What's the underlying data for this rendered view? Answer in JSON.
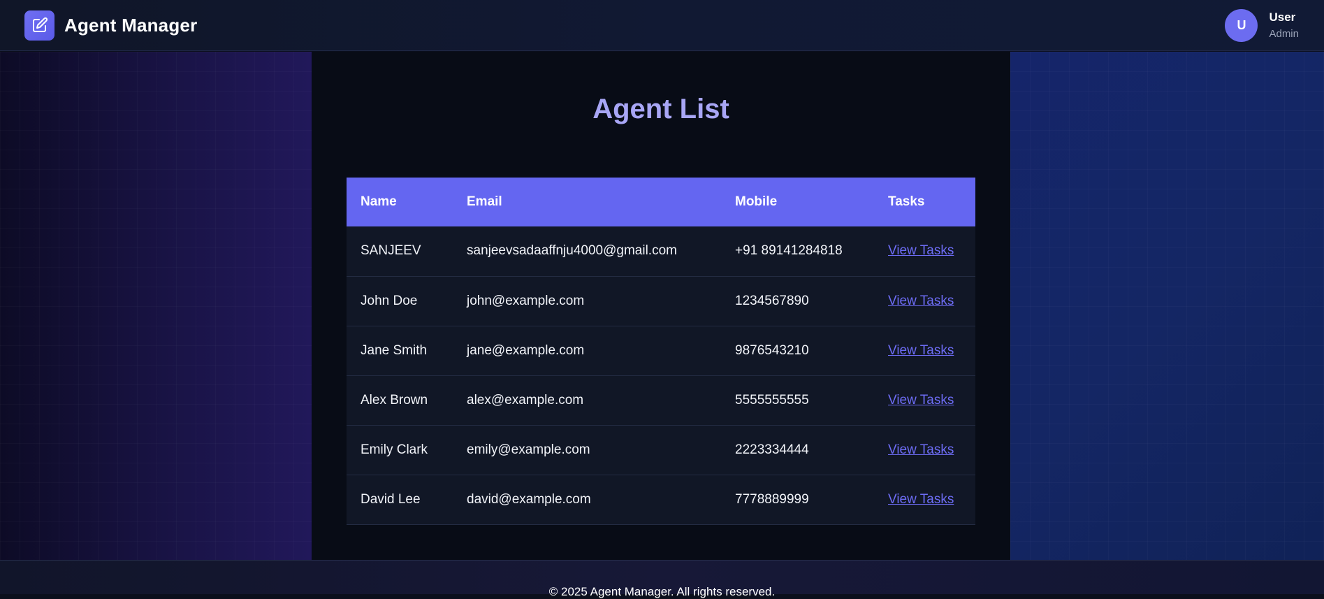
{
  "header": {
    "brand_icon": "edit-icon",
    "brand_title": "Agent Manager",
    "user": {
      "avatar_initial": "U",
      "name": "User",
      "role": "Admin"
    }
  },
  "main": {
    "title": "Agent List",
    "table": {
      "columns": [
        "Name",
        "Email",
        "Mobile",
        "Tasks"
      ],
      "rows": [
        {
          "name": "SANJEEV",
          "email": "sanjeevsadaaffnju4000@gmail.com",
          "mobile": "+91 89141284818",
          "tasks": "View Tasks"
        },
        {
          "name": "John Doe",
          "email": "john@example.com",
          "mobile": "1234567890",
          "tasks": "View Tasks"
        },
        {
          "name": "Jane Smith",
          "email": "jane@example.com",
          "mobile": "9876543210",
          "tasks": "View Tasks"
        },
        {
          "name": "Alex Brown",
          "email": "alex@example.com",
          "mobile": "5555555555",
          "tasks": "View Tasks"
        },
        {
          "name": "Emily Clark",
          "email": "emily@example.com",
          "mobile": "2223334444",
          "tasks": "View Tasks"
        },
        {
          "name": "David Lee",
          "email": "david@example.com",
          "mobile": "7778889999",
          "tasks": "View Tasks"
        }
      ]
    }
  },
  "footer": {
    "text": "© 2025 Agent Manager. All rights reserved."
  },
  "colors": {
    "accent": "#6466f1",
    "title": "#a8a6f5",
    "link": "#6d6cf4",
    "panel": "#080c16"
  }
}
